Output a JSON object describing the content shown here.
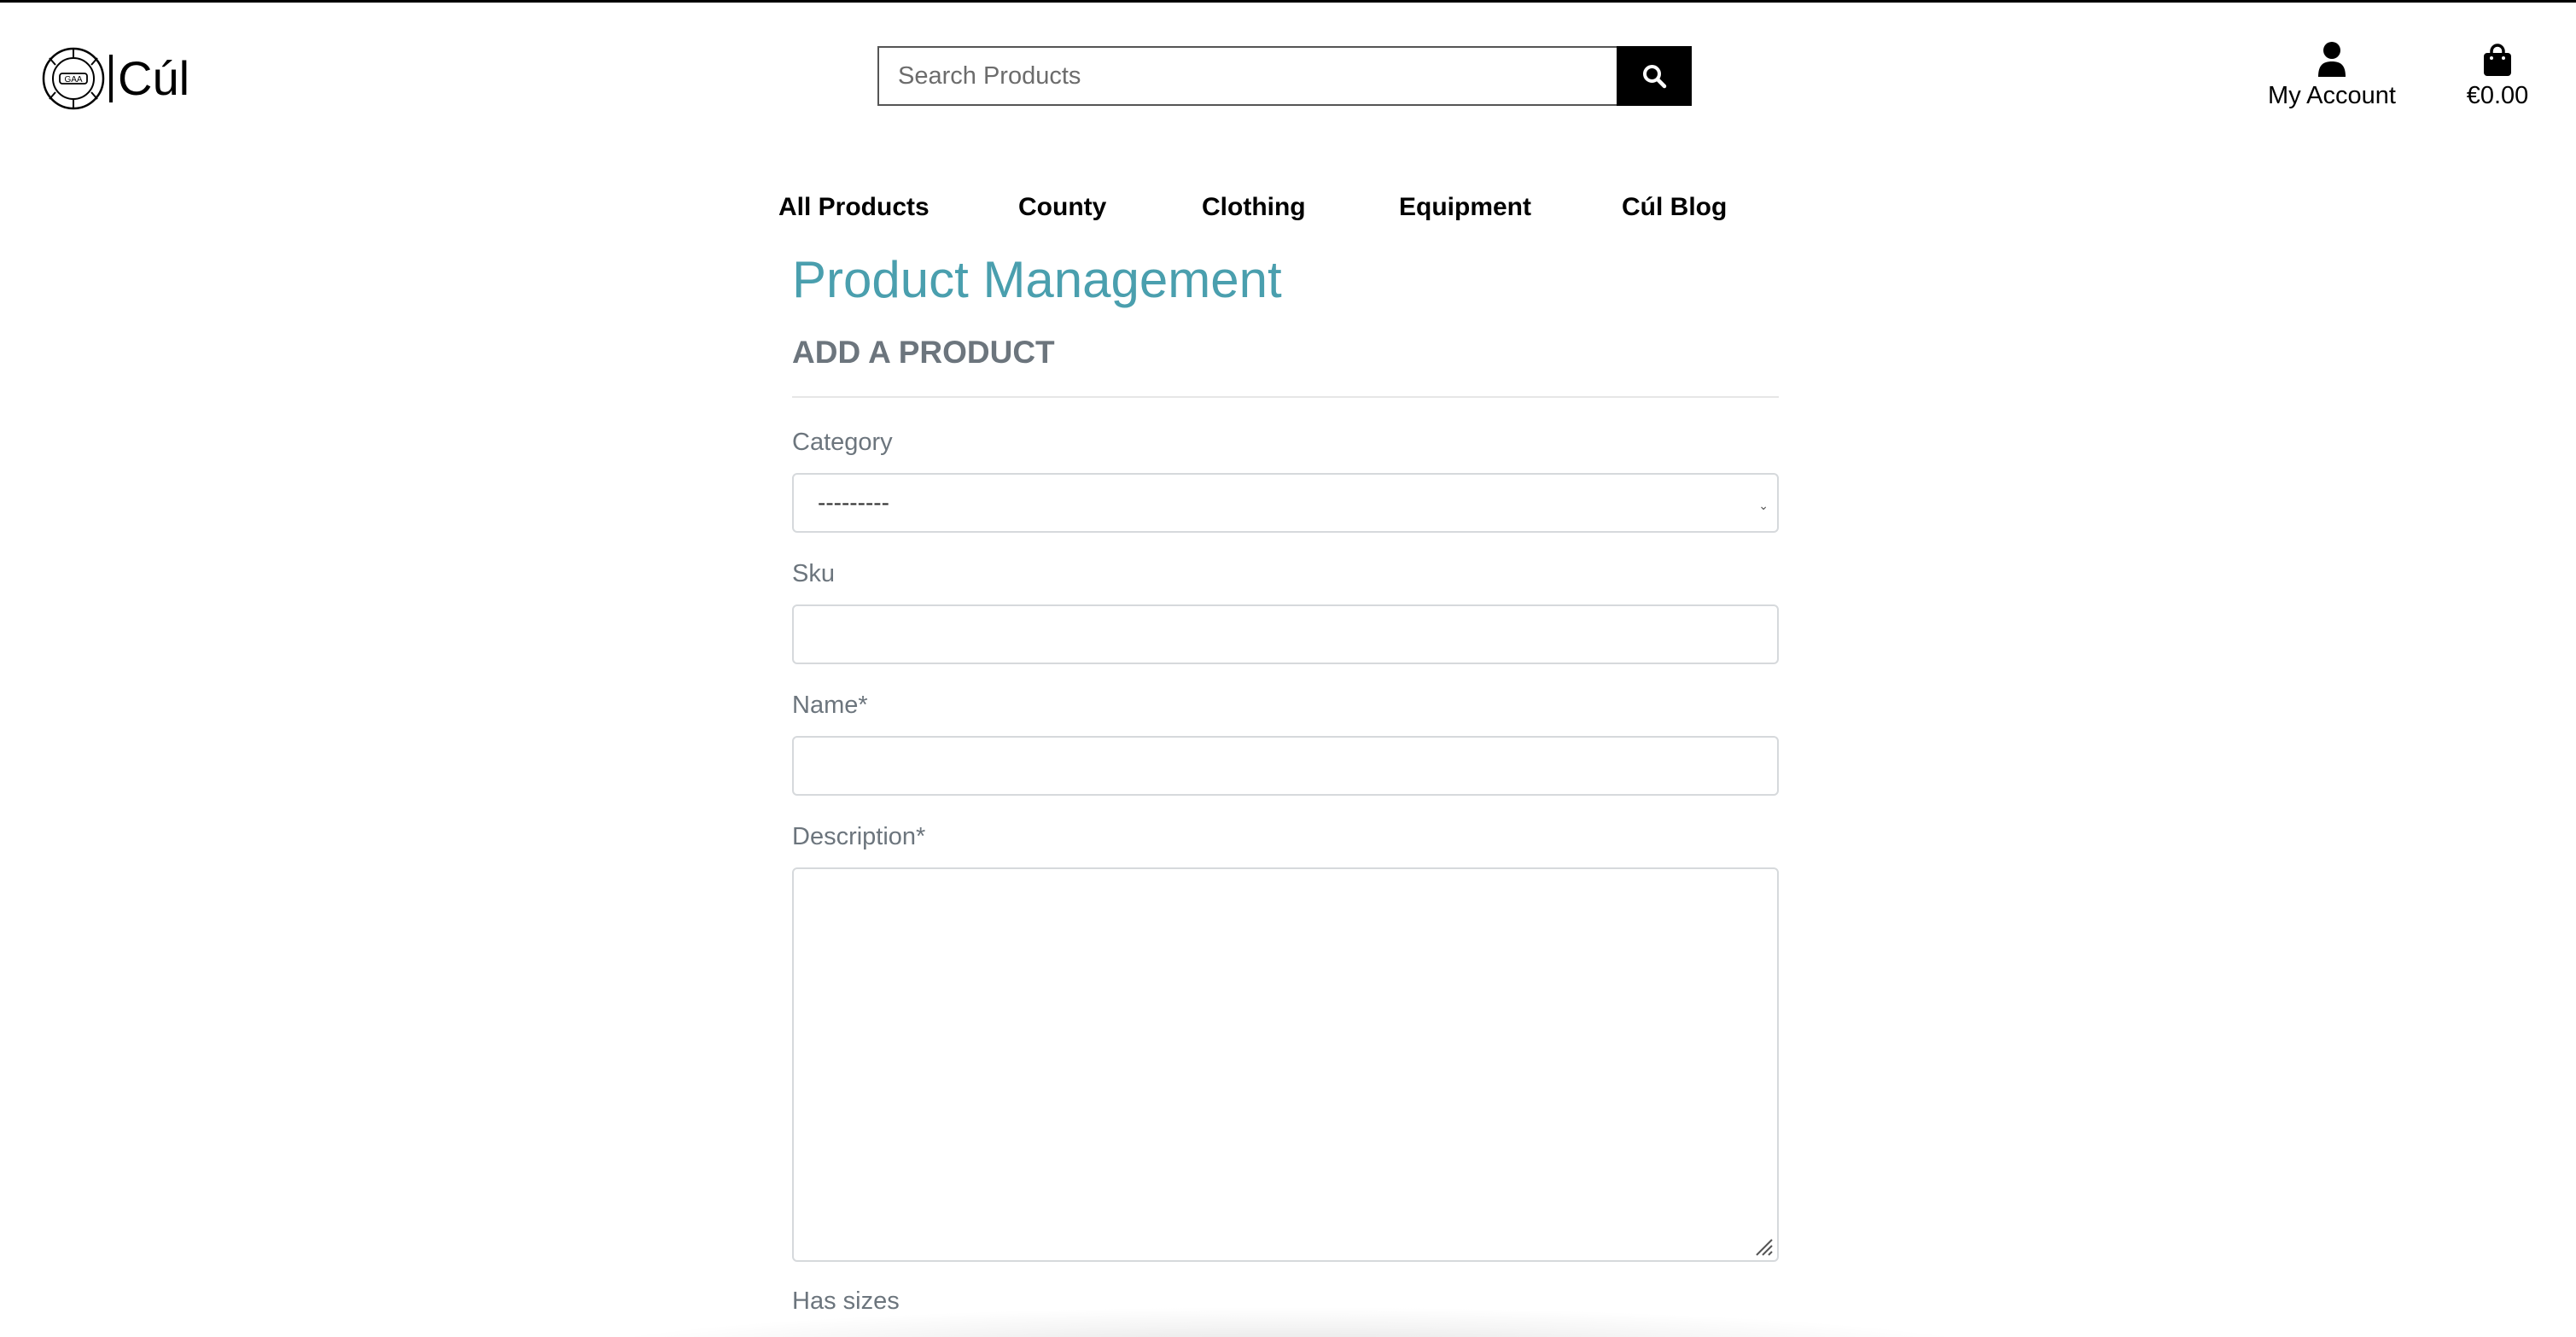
{
  "brand": {
    "name": "Cúl",
    "logo_icon": "gaa-ball-logo-icon"
  },
  "search": {
    "placeholder": "Search Products",
    "icon": "search-icon"
  },
  "header": {
    "account_label": "My Account",
    "account_icon": "user-icon",
    "cart_total": "€0.00",
    "cart_icon": "shopping-bag-icon"
  },
  "nav": {
    "items": [
      {
        "label": "All Products"
      },
      {
        "label": "County"
      },
      {
        "label": "Clothing"
      },
      {
        "label": "Equipment"
      },
      {
        "label": "Cúl Blog"
      }
    ]
  },
  "page": {
    "title": "Product Management",
    "section": "ADD A PRODUCT"
  },
  "form": {
    "category_label": "Category",
    "category_value": "---------",
    "sku_label": "Sku",
    "name_label": "Name*",
    "description_label": "Description*",
    "has_sizes_label": "Has sizes"
  },
  "colors": {
    "accent": "#4a9fae",
    "muted_text": "#6c757d",
    "field_border": "#d6d9dc"
  }
}
